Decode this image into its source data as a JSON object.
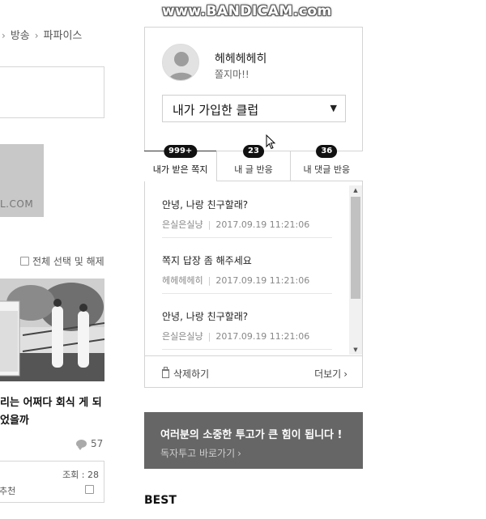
{
  "watermark": "www.BANDICAM.com",
  "breadcrumb": {
    "items": [
      "방송",
      "파파이스"
    ]
  },
  "banner": {
    "text": "L.COM"
  },
  "list": {
    "select_all_label": "전체 선택 및 해제"
  },
  "article": {
    "title": "리는 어쩌다 회식 게 되었을까",
    "comments": "57",
    "views": "조회 : 28",
    "recommend": "추천"
  },
  "profile": {
    "username": "헤헤헤헤히",
    "status": "쫄지마!!"
  },
  "club_select": {
    "selected": "내가 가입한 클럽"
  },
  "tabs": [
    {
      "label": "내가 받은 쪽지",
      "badge": "999+"
    },
    {
      "label": "내 글 반응",
      "badge": "23"
    },
    {
      "label": "내 댓글 반응",
      "badge": "36"
    }
  ],
  "messages": [
    {
      "title": "안녕, 나랑 친구할래?",
      "author": "은실은실냥",
      "date": "2017.09.19 11:21:06"
    },
    {
      "title": "쪽지 답장 좀 해주세요",
      "author": "헤헤헤헤히",
      "date": "2017.09.19 11:21:06"
    },
    {
      "title": "안녕, 나랑 친구할래?",
      "author": "은실은실냥",
      "date": "2017.09.19 11:21:06"
    }
  ],
  "panel_footer": {
    "delete_label": "삭제하기",
    "more_label": "더보기"
  },
  "contrib": {
    "title": "여러분의 소중한 투고가 큰 힘이 됩니다 !",
    "link": "독자투고 바로가기"
  },
  "best": {
    "label": "BEST"
  },
  "icons": {
    "trash": "trash-icon",
    "chevron": "chevron-right-icon",
    "comment": "comment-bubble-icon",
    "avatar": "user-avatar-icon"
  }
}
